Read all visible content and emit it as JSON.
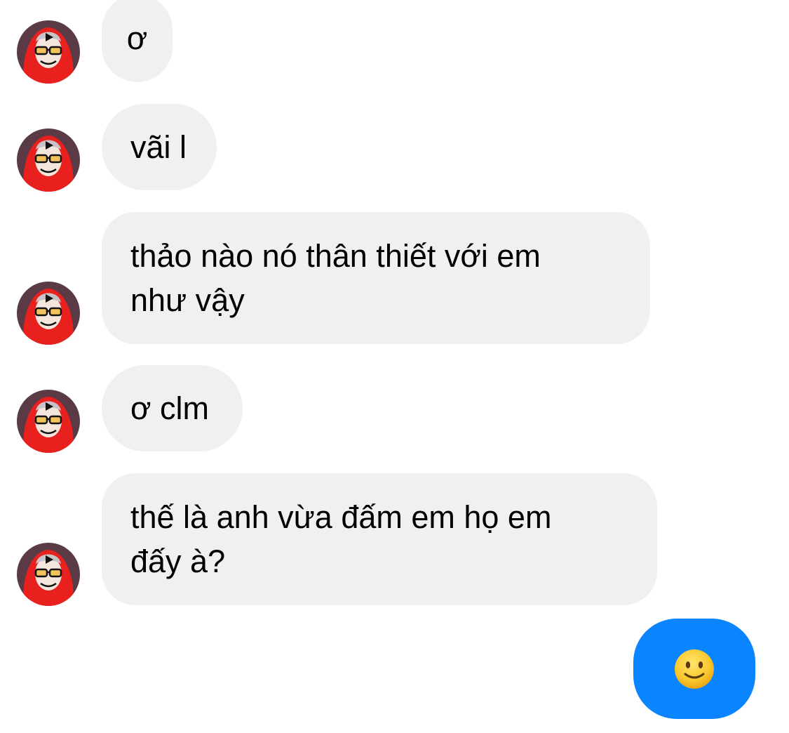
{
  "conversation": {
    "messages": [
      {
        "text": "ơ"
      },
      {
        "text": "vãi l"
      },
      {
        "text": "thảo nào nó thân thiết với em\nnhư vậy"
      },
      {
        "text": "ơ clm"
      },
      {
        "text": "thế là anh vừa đấm em họ em\nđấy à?"
      }
    ],
    "sent_reaction": {
      "emoji": "🙂",
      "icon": "slightly-smiling-face-icon"
    }
  },
  "colors": {
    "incoming_bubble": "#f0f0f0",
    "outgoing_bubble": "#0a84ff",
    "avatar_hood": "#e8201e"
  }
}
